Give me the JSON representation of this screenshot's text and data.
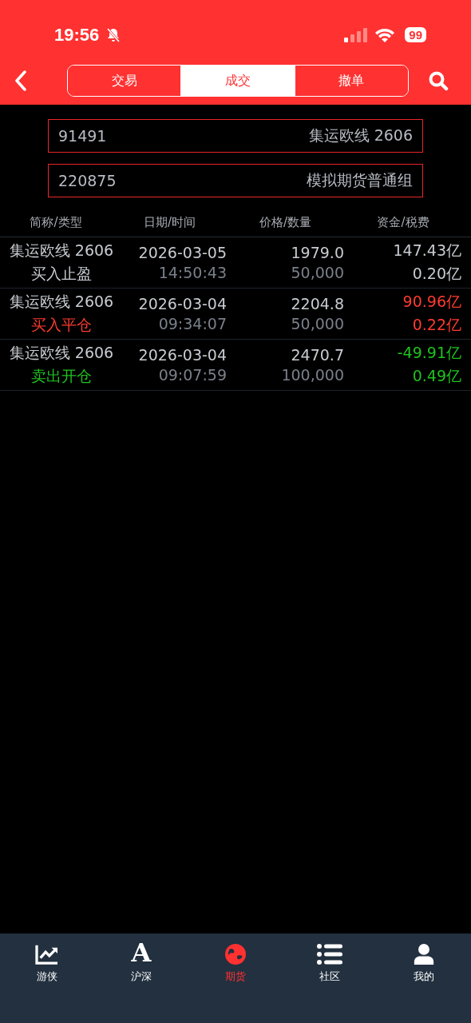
{
  "status_bar": {
    "time": "19:56",
    "battery": "99"
  },
  "nav": {
    "tabs": [
      {
        "label": "交易",
        "selected": false
      },
      {
        "label": "成交",
        "selected": true
      },
      {
        "label": "撤单",
        "selected": false
      }
    ]
  },
  "filters": [
    {
      "value": "91491",
      "label": "集运欧线 2606"
    },
    {
      "value": "220875",
      "label": "模拟期货普通组"
    }
  ],
  "table": {
    "columns": [
      "简称/类型",
      "日期/时间",
      "价格/数量",
      "资金/税费"
    ],
    "rows": [
      {
        "name": "集运欧线 2606",
        "type": "买入止盈",
        "date": "2026-03-05",
        "time": "14:50:43",
        "price": "1979.0",
        "quantity": "50,000",
        "funds": "147.43亿",
        "fee": "0.20亿",
        "color": "#c8ccd2"
      },
      {
        "name": "集运欧线 2606",
        "type": "买入平仓",
        "date": "2026-03-04",
        "time": "09:34:07",
        "price": "2204.8",
        "quantity": "50,000",
        "funds": "90.96亿",
        "fee": "0.22亿",
        "color": "#ff3b30"
      },
      {
        "name": "集运欧线 2606",
        "type": "卖出开仓",
        "date": "2026-03-04",
        "time": "09:07:59",
        "price": "2470.7",
        "quantity": "100,000",
        "funds": "-49.91亿",
        "fee": "0.49亿",
        "color": "#1fc21f"
      }
    ]
  },
  "tab_bar": [
    {
      "kind": "chart",
      "label": "游侠",
      "selected": false
    },
    {
      "kind": "letter",
      "glyph": "A",
      "label": "沪深",
      "selected": false
    },
    {
      "kind": "globe",
      "label": "期货",
      "selected": true
    },
    {
      "kind": "list",
      "label": "社区",
      "selected": false
    },
    {
      "kind": "person",
      "label": "我的",
      "selected": false
    }
  ]
}
